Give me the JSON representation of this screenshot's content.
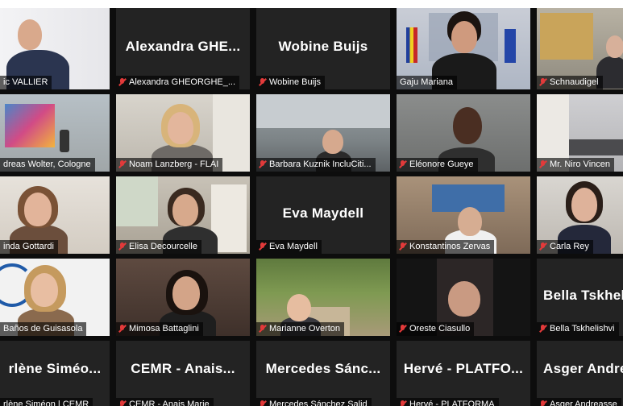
{
  "meeting": {
    "participants": [
      {
        "id": "vallier",
        "big_name": "",
        "label": "ic VALLIER",
        "muted": false,
        "video": true
      },
      {
        "id": "gheorghe",
        "big_name": "Alexandra GHE...",
        "label": "Alexandra GHEORGHE_...",
        "muted": true,
        "video": false
      },
      {
        "id": "buijs",
        "big_name": "Wobine Buijs",
        "label": "Wobine Buijs",
        "muted": true,
        "video": false
      },
      {
        "id": "gaju",
        "big_name": "",
        "label": "Gaju Mariana",
        "muted": false,
        "video": true,
        "active_speaker": true
      },
      {
        "id": "schnaudigel",
        "big_name": "",
        "label": "Schnaudigel",
        "muted": true,
        "video": true
      },
      {
        "id": "wolter",
        "big_name": "",
        "label": "dreas Wolter, Cologne",
        "muted": false,
        "video": true
      },
      {
        "id": "lanzberg",
        "big_name": "",
        "label": "Noam Lanzberg - FLAI",
        "muted": true,
        "video": true
      },
      {
        "id": "kuznik",
        "big_name": "",
        "label": "Barbara Kuznik IncluCiti...",
        "muted": true,
        "video": true
      },
      {
        "id": "gueye",
        "big_name": "",
        "label": "Eléonore Gueye",
        "muted": true,
        "video": true
      },
      {
        "id": "vincen",
        "big_name": "",
        "label": "Mr. Niro Vincen",
        "muted": true,
        "video": true
      },
      {
        "id": "gottardi",
        "big_name": "",
        "label": "inda Gottardi",
        "muted": false,
        "video": true
      },
      {
        "id": "decourcelle",
        "big_name": "",
        "label": "Elisa Decourcelle",
        "muted": true,
        "video": true
      },
      {
        "id": "maydell",
        "big_name": "Eva Maydell",
        "label": "Eva Maydell",
        "muted": true,
        "video": false
      },
      {
        "id": "zervas",
        "big_name": "",
        "label": "Konstantinos Zervas",
        "muted": true,
        "video": true
      },
      {
        "id": "rey",
        "big_name": "",
        "label": "Carla Rey",
        "muted": true,
        "video": true
      },
      {
        "id": "guisasola",
        "big_name": "",
        "label": "Baños de Guisasola",
        "muted": false,
        "video": true
      },
      {
        "id": "battaglini",
        "big_name": "",
        "label": "Mimosa Battaglini",
        "muted": true,
        "video": true
      },
      {
        "id": "overton",
        "big_name": "",
        "label": "Marianne Overton",
        "muted": true,
        "video": true
      },
      {
        "id": "ciasullo",
        "big_name": "",
        "label": "Oreste Ciasullo",
        "muted": true,
        "video": true
      },
      {
        "id": "tskhel",
        "big_name": "Bella Tskhel",
        "label": "Bella Tskhelishvi",
        "muted": true,
        "video": false
      },
      {
        "id": "simeon",
        "big_name": "rlène Siméo...",
        "label": "rlène Siméon | CEMR",
        "muted": false,
        "video": false
      },
      {
        "id": "cemr_anais",
        "big_name": "CEMR - Anais...",
        "label": "CEMR - Anais Marie",
        "muted": true,
        "video": false
      },
      {
        "id": "mercedes",
        "big_name": "Mercedes Sánc...",
        "label": "Mercedes Sánchez Salid",
        "muted": true,
        "video": false
      },
      {
        "id": "herve",
        "big_name": "Hervé - PLATFO...",
        "label": "Hervé - PLATFORMA",
        "muted": true,
        "video": false
      },
      {
        "id": "asger",
        "big_name": "Asger Andre",
        "label": "Asger Andreasse",
        "muted": true,
        "video": false
      }
    ],
    "colors": {
      "active_speaker_border": "#f0e63a",
      "muted_icon": "#e23a3a",
      "tile_blank": "#232323",
      "background": "#0d0d0d"
    }
  }
}
